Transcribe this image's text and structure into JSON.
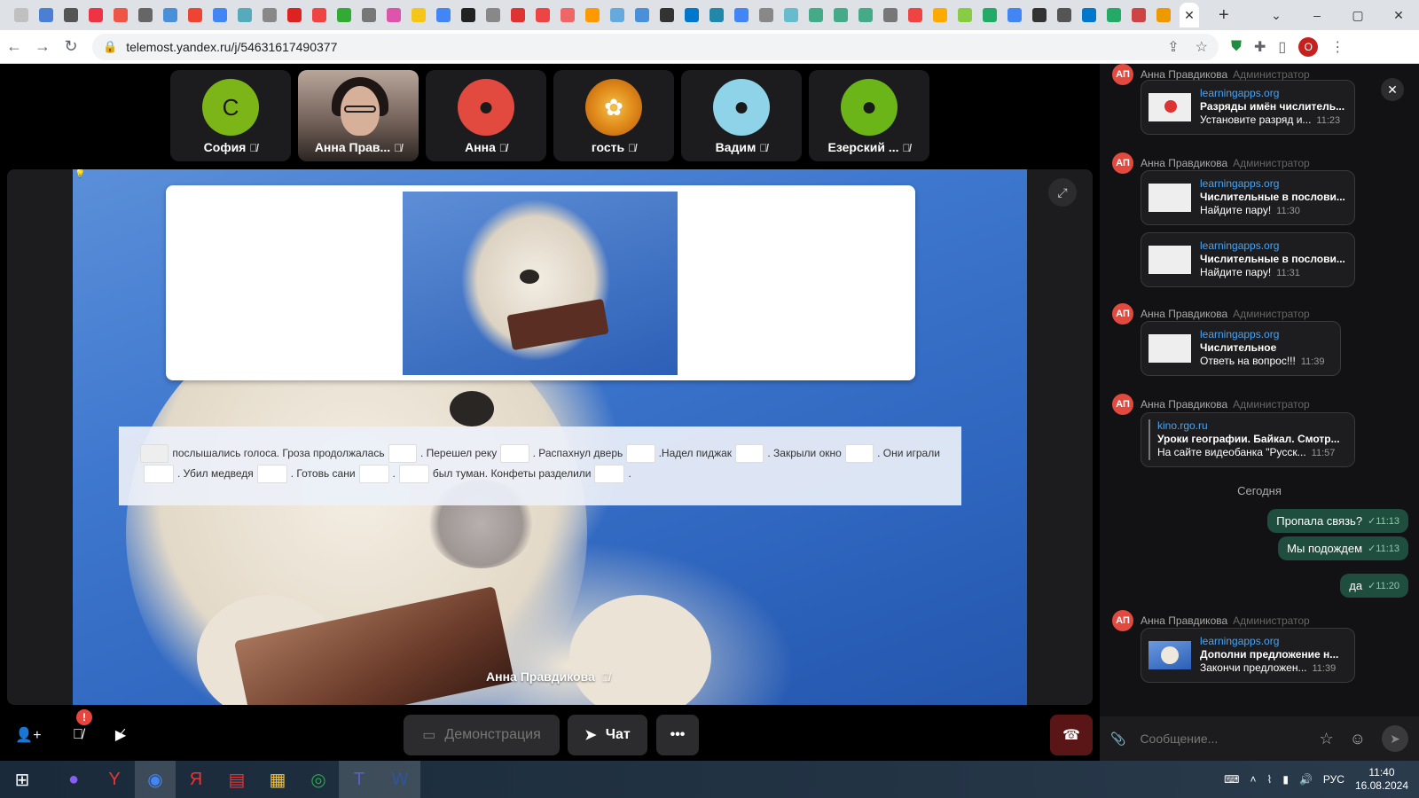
{
  "browser": {
    "url": "telemost.yandex.ru/j/54631617490377",
    "tab_colors": [
      "#c0c0c0",
      "#4a7fd4",
      "#555",
      "#e34",
      "#e54",
      "#666",
      "#4a90d9",
      "#e43",
      "#4285f4",
      "#5ab",
      "#888",
      "#d22",
      "#e44",
      "#3a3",
      "#777",
      "#d5a",
      "#f5c518",
      "#4285f4",
      "#222",
      "#888",
      "#d33",
      "#e44",
      "#e66",
      "#f90",
      "#6ad",
      "#4a90d9",
      "#333",
      "#07c",
      "#28a",
      "#4285f4",
      "#888",
      "#6bc",
      "#4a8",
      "#4a8",
      "#4a8",
      "#777",
      "#e44",
      "#fa0",
      "#8c4",
      "#2a6",
      "#4285f4",
      "#333",
      "#555",
      "#07c",
      "#2a6",
      "#c44",
      "#e90"
    ],
    "window_controls": [
      "–",
      "▢",
      "✕"
    ]
  },
  "participants": [
    {
      "name": "София",
      "initial": "С",
      "color": "#7cb518",
      "type": "initial"
    },
    {
      "name": "Анна Прав...",
      "type": "photo"
    },
    {
      "name": "Анна",
      "color": "#e34a3f",
      "type": "person"
    },
    {
      "name": "гость",
      "color": "#e8a23a",
      "type": "flower"
    },
    {
      "name": "Вадим",
      "color": "#8fd3e8",
      "type": "person"
    },
    {
      "name": "Езерский ...",
      "color": "#6cb518",
      "type": "person"
    }
  ],
  "stage": {
    "speaker_name": "Анна Правдикова",
    "exercise_line1": [
      {
        "blank": true
      },
      {
        "text": "послышались голоса. Гроза продолжалась"
      },
      {
        "blank": true
      },
      {
        "text": ". Перешел реку"
      },
      {
        "blank": true
      },
      {
        "text": ". Распахнул дверь"
      },
      {
        "blank": true
      },
      {
        "text": ".Надел пиджак"
      },
      {
        "blank": true
      },
      {
        "text": ". Закрыли окно"
      },
      {
        "blank": true
      },
      {
        "text": ". Они играли"
      }
    ],
    "exercise_line2": [
      {
        "blank": true
      },
      {
        "text": ". Убил медведя"
      },
      {
        "blank": true
      },
      {
        "text": ". Готовь сани"
      },
      {
        "blank": true
      },
      {
        "text": "."
      },
      {
        "blank": true
      },
      {
        "text": "был туман. Конфеты разделили"
      },
      {
        "blank": true
      },
      {
        "text": "."
      }
    ]
  },
  "controls": {
    "mic_badge": "!",
    "demo_label": "Демонстрация",
    "chat_label": "Чат",
    "more_label": "•••"
  },
  "chat": {
    "messages": [
      {
        "author": "Анна Правдикова",
        "initials": "АП",
        "role": "Администратор",
        "link": "learningapps.org",
        "title": "Разряды имён числитель...",
        "desc": "Установите разряд и...",
        "time": "11:23",
        "thumb": "red"
      },
      {
        "author": "Анна Правдикова",
        "initials": "АП",
        "role": "Администратор",
        "link": "learningapps.org",
        "title": "Числительные в послови...",
        "desc": "Найдите пару!",
        "time": "11:30",
        "thumb": "grid"
      },
      {
        "link": "learningapps.org",
        "title": "Числительные в послови...",
        "desc": "Найдите пару!",
        "time": "11:31",
        "thumb": "grid"
      },
      {
        "author": "Анна Правдикова",
        "initials": "АП",
        "role": "Администратор",
        "link": "learningapps.org",
        "title": "Числительное",
        "desc": "Ответь на вопрос!!!",
        "time": "11:39",
        "thumb": "grid"
      },
      {
        "author": "Анна Правдикова",
        "initials": "АП",
        "role": "Администратор",
        "link": "kino.rgo.ru",
        "title": "Уроки географии. Байкал. Смотр...",
        "desc": "На сайте видеобанка \"Русск...",
        "time": "11:57",
        "thumb": "none"
      }
    ],
    "today_label": "Сегодня",
    "outgoing": [
      {
        "text": "Пропала связь?",
        "time": "11:13"
      },
      {
        "text": "Мы подождем",
        "time": "11:13"
      },
      {
        "text": "да",
        "time": "11:20"
      }
    ],
    "last_message": {
      "author": "Анна Правдикова",
      "initials": "АП",
      "role": "Администратор",
      "link": "learningapps.org",
      "title": "Дополни предложение н...",
      "desc": "Закончи предложен...",
      "time": "11:39"
    },
    "input_placeholder": "Сообщение..."
  },
  "taskbar": {
    "apps": [
      "⊞",
      "●",
      "Y",
      "◉",
      "Я",
      "▤",
      "▦",
      "◎",
      "T",
      "W"
    ],
    "lang": "РУС",
    "time": "11:40",
    "date": "16.08.2024"
  }
}
